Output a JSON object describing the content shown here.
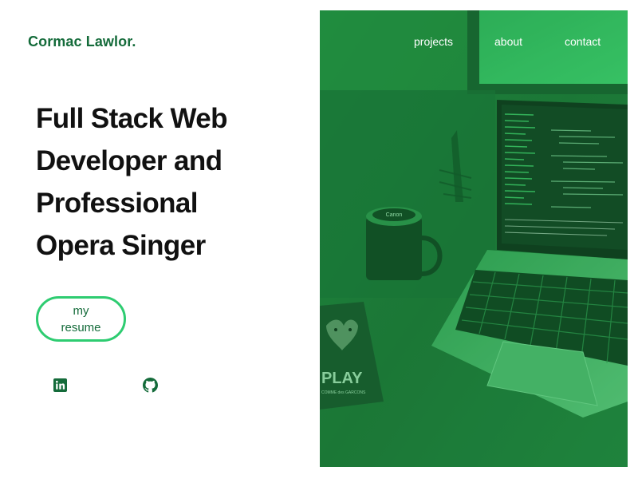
{
  "header": {
    "brand": "Cormac Lawlor."
  },
  "nav": {
    "items": [
      "projects",
      "about",
      "contact"
    ]
  },
  "hero": {
    "headline": [
      "Full Stack Web",
      "Developer and",
      "Professional",
      "Opera Singer"
    ],
    "resume_button": "my resume",
    "photo_texts": {
      "camera_lens": "Canon",
      "book_cover": "PLAY",
      "book_subtitle": "COMME des GARCONS"
    }
  },
  "social": [
    {
      "icon": "linkedin-icon"
    },
    {
      "icon": "github-icon"
    }
  ],
  "colors": {
    "brand_green": "#146b3a",
    "button_border": "#2ecc71",
    "overlay_green": "#1f8a3e",
    "text_dark": "#111111"
  }
}
